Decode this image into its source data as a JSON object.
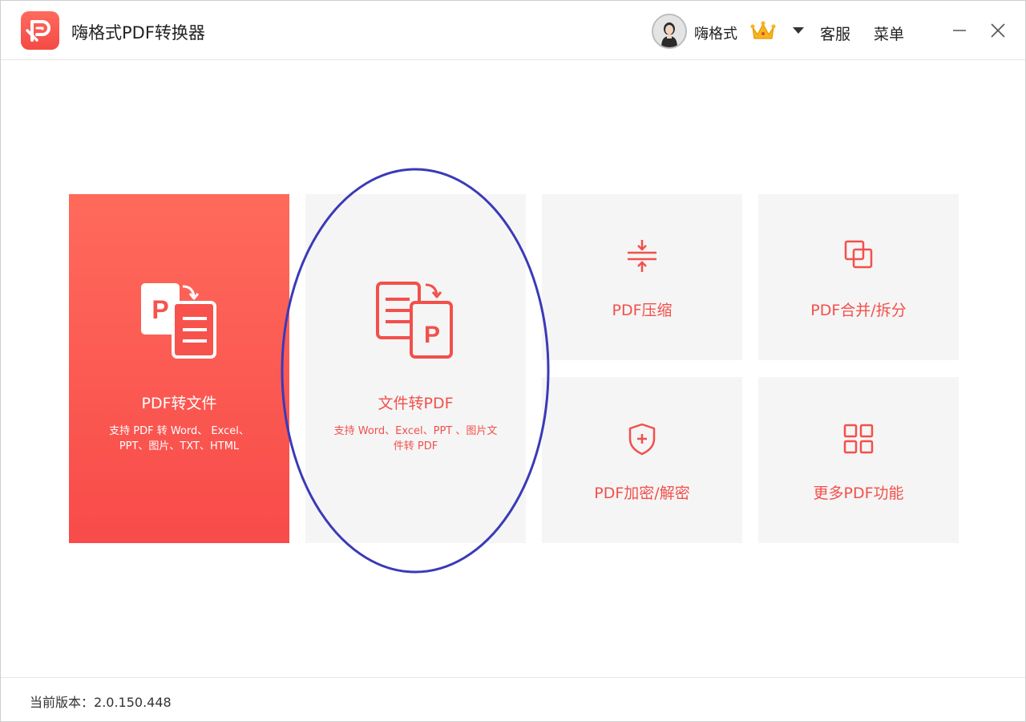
{
  "app": {
    "title": "嗨格式PDF转换器",
    "brand_color": "#f2504b",
    "logo_icon": "pdf-p-logo-icon"
  },
  "header": {
    "user_name": "嗨格式",
    "vip_icon": "crown-icon",
    "service_label": "客服",
    "menu_label": "菜单",
    "minimize_glyph": "—",
    "close_glyph": "✕"
  },
  "cards": {
    "pdf_to_file": {
      "title": "PDF转文件",
      "desc": "支持 PDF 转 Word、 Excel、 PPT、图片、TXT、HTML",
      "icon": "pdf-to-doc-icon"
    },
    "file_to_pdf": {
      "title": "文件转PDF",
      "desc": "支持 Word、Excel、PPT 、图片文件转 PDF",
      "icon": "doc-to-pdf-icon"
    },
    "compress": {
      "title": "PDF压缩",
      "icon": "compress-icon"
    },
    "merge_split": {
      "title": "PDF合并/拆分",
      "icon": "merge-icon"
    },
    "encrypt": {
      "title": "PDF加密/解密",
      "icon": "shield-icon"
    },
    "more": {
      "title": "更多PDF功能",
      "icon": "grid-icon"
    }
  },
  "annotation": {
    "shape": "ellipse",
    "color": "#3a3ab8",
    "target": "file_to_pdf"
  },
  "footer": {
    "version_label": "当前版本：",
    "version": "2.0.150.448"
  }
}
